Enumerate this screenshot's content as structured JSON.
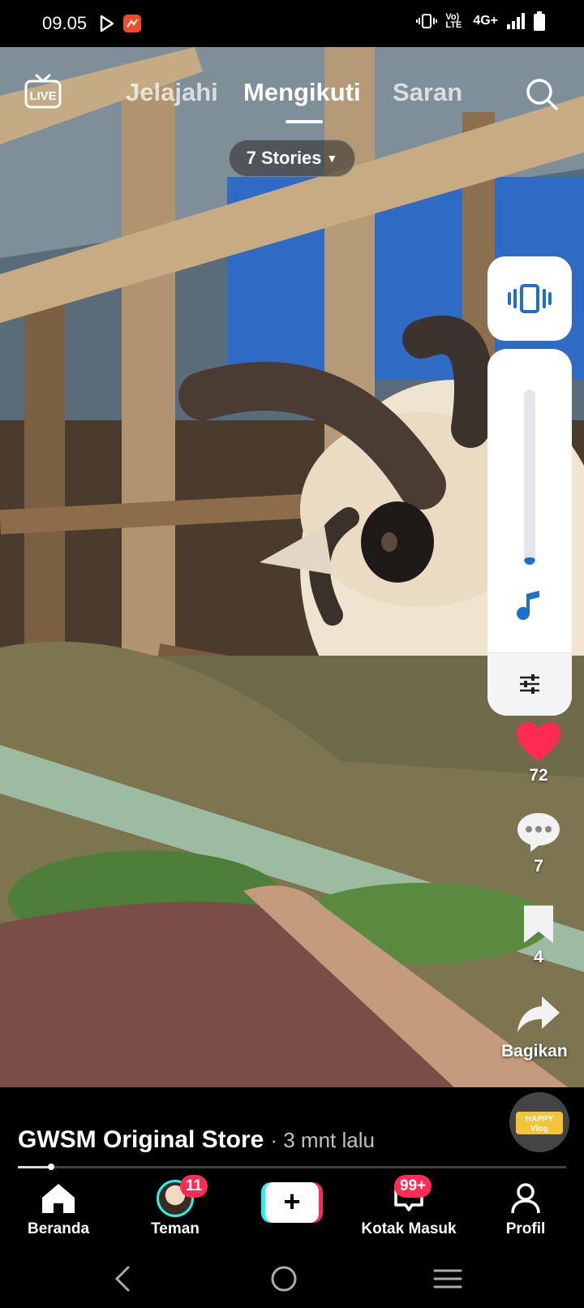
{
  "status_bar": {
    "time": "09.05",
    "network": "4G+",
    "volte": "Vo) LTE"
  },
  "top_nav": {
    "tabs": [
      {
        "label": "Jelajahi",
        "active": false
      },
      {
        "label": "Mengikuti",
        "active": true
      },
      {
        "label": "Saran",
        "active": false
      }
    ],
    "stories_label": "7 Stories",
    "live_label": "LIVE"
  },
  "volume_panel": {
    "level": 0.04
  },
  "actions": {
    "likes": "72",
    "comments": "7",
    "bookmarks": "4",
    "share_label": "Bagikan"
  },
  "post": {
    "author": "GWSM Original Store",
    "time_ago": "· 3 mnt lalu",
    "progress": 0.06,
    "sound_disc_text": "HAPPY Vlog"
  },
  "bottom_nav": {
    "items": [
      {
        "label": "Beranda",
        "icon": "home-icon",
        "badge": ""
      },
      {
        "label": "Teman",
        "icon": "friends-avatar",
        "badge": "11"
      },
      {
        "label": "",
        "icon": "plus-icon",
        "badge": ""
      },
      {
        "label": "Kotak Masuk",
        "icon": "inbox-icon",
        "badge": "99+"
      },
      {
        "label": "Profil",
        "icon": "profile-icon",
        "badge": ""
      }
    ]
  },
  "colors": {
    "accent_red": "#fe2c55",
    "accent_cyan": "#25f4ee",
    "volume_blue": "#1f6fd1",
    "heart_red": "#fe2c55"
  }
}
